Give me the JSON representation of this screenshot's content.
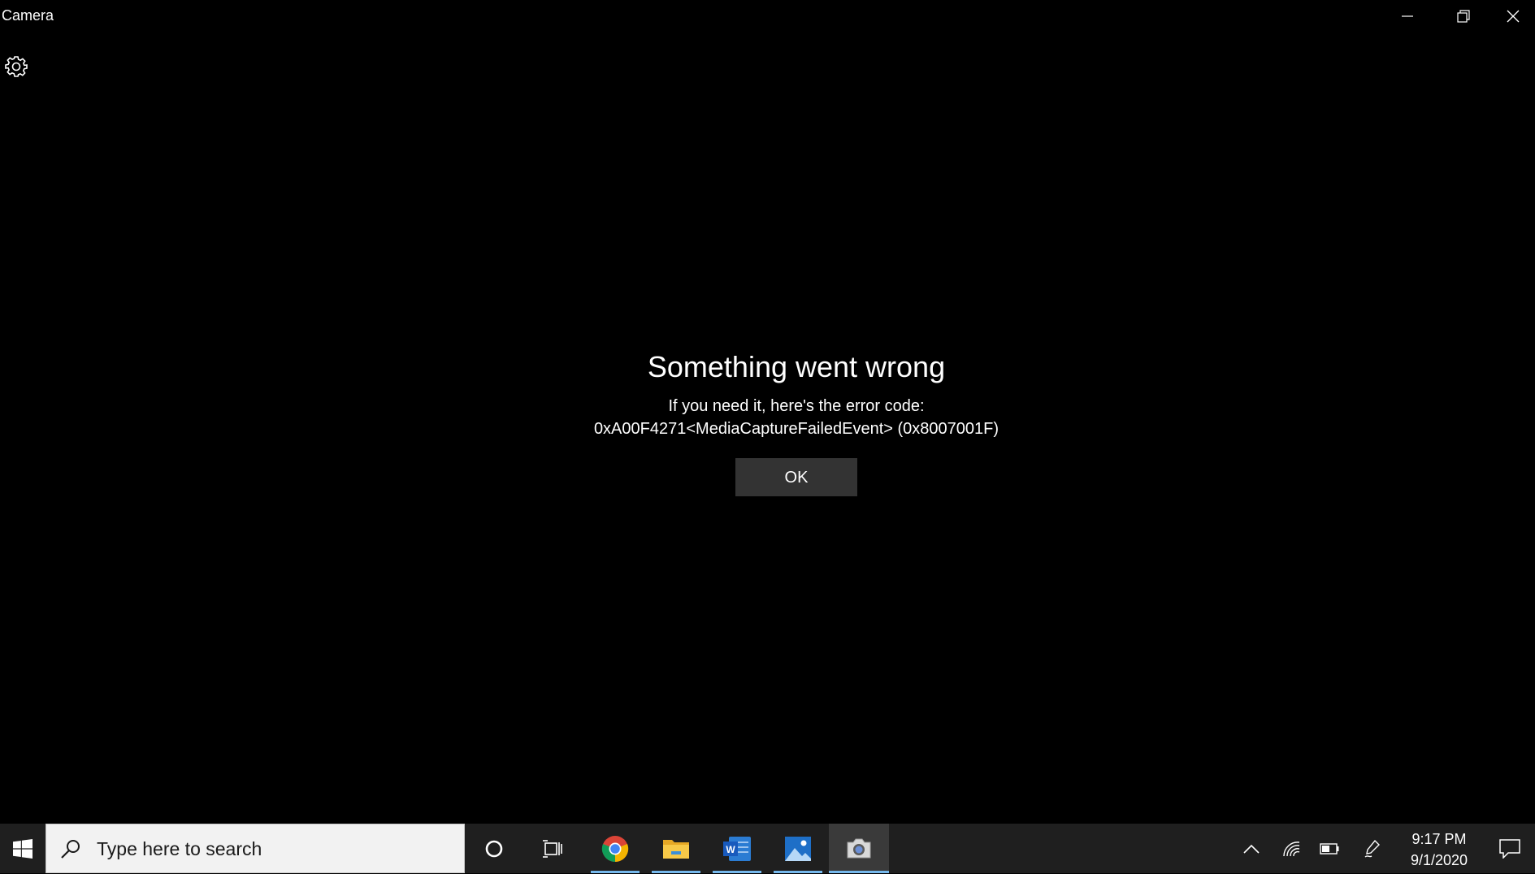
{
  "window": {
    "title": "Camera",
    "controls": {
      "minimize_icon": "minimize-icon",
      "restore_icon": "restore-icon",
      "close_icon": "close-icon"
    },
    "settings_icon": "gear-icon"
  },
  "error_dialog": {
    "title": "Something went wrong",
    "message": "If you need it, here's the error code:",
    "code": "0xA00F4271<MediaCaptureFailedEvent> (0x8007001F)",
    "ok_label": "OK"
  },
  "taskbar": {
    "search": {
      "placeholder": "Type here to search",
      "value": ""
    },
    "apps": [
      {
        "name": "cortana",
        "icon": "cortana-circle-icon",
        "active": false
      },
      {
        "name": "task-view",
        "icon": "task-view-icon",
        "active": false
      },
      {
        "name": "chrome",
        "icon": "chrome-icon",
        "active": true
      },
      {
        "name": "file-explorer",
        "icon": "folder-icon",
        "active": true
      },
      {
        "name": "word",
        "icon": "word-icon",
        "active": true
      },
      {
        "name": "photos",
        "icon": "photos-icon",
        "active": true
      },
      {
        "name": "camera",
        "icon": "camera-icon",
        "active": true,
        "focused": true
      }
    ],
    "tray": {
      "time": "9:17 PM",
      "date": "9/1/2020"
    }
  },
  "colors": {
    "background": "#000000",
    "button_bg": "#333333",
    "taskbar_bg": "#1f1f1f",
    "active_indicator": "#76b9ed"
  }
}
